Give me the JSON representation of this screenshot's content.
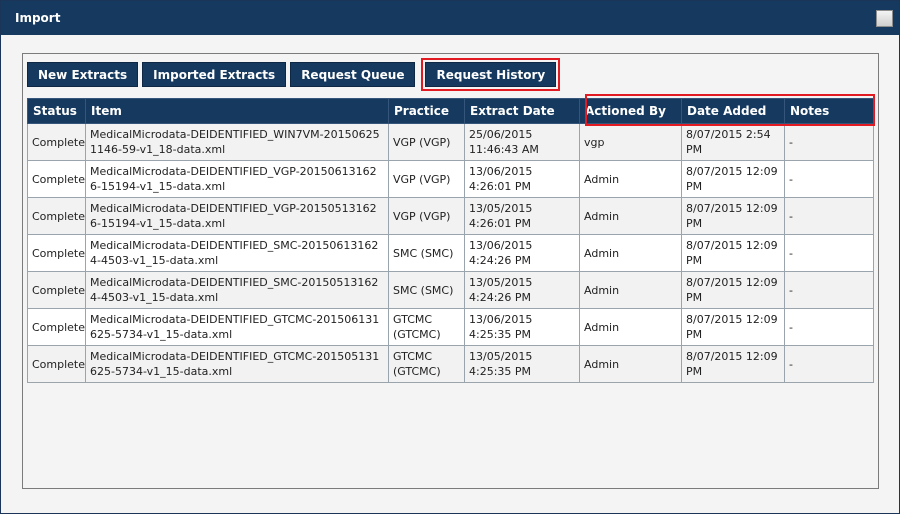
{
  "window": {
    "title": "Import"
  },
  "tabs": [
    {
      "label": "New Extracts"
    },
    {
      "label": "Imported Extracts"
    },
    {
      "label": "Request Queue"
    },
    {
      "label": "Request History"
    }
  ],
  "table": {
    "headers": [
      "Status",
      "Item",
      "Practice",
      "Extract Date",
      "Actioned By",
      "Date Added",
      "Notes"
    ],
    "rows": [
      [
        "Complete",
        "MedicalMicrodata-DEIDENTIFIED_WIN7VM-20150625\n1146-59-v1_18-data.xml",
        "VGP (VGP)",
        "25/06/2015\n11:46:43 AM",
        "vgp",
        "8/07/2015 2:54\nPM",
        "-"
      ],
      [
        "Complete",
        "MedicalMicrodata-DEIDENTIFIED_VGP-20150613162\n6-15194-v1_15-data.xml",
        "VGP (VGP)",
        "13/06/2015\n4:26:01 PM",
        "Admin",
        "8/07/2015 12:09\nPM",
        "-"
      ],
      [
        "Complete",
        "MedicalMicrodata-DEIDENTIFIED_VGP-20150513162\n6-15194-v1_15-data.xml",
        "VGP (VGP)",
        "13/05/2015\n4:26:01 PM",
        "Admin",
        "8/07/2015 12:09\nPM",
        "-"
      ],
      [
        "Complete",
        "MedicalMicrodata-DEIDENTIFIED_SMC-20150613162\n4-4503-v1_15-data.xml",
        "SMC (SMC)",
        "13/06/2015\n4:24:26 PM",
        "Admin",
        "8/07/2015 12:09\nPM",
        "-"
      ],
      [
        "Complete",
        "MedicalMicrodata-DEIDENTIFIED_SMC-20150513162\n4-4503-v1_15-data.xml",
        "SMC (SMC)",
        "13/05/2015\n4:24:26 PM",
        "Admin",
        "8/07/2015 12:09\nPM",
        "-"
      ],
      [
        "Complete",
        "MedicalMicrodata-DEIDENTIFIED_GTCMC-201506131\n625-5734-v1_15-data.xml",
        "GTCMC\n(GTCMC)",
        "13/06/2015\n4:25:35 PM",
        "Admin",
        "8/07/2015 12:09\nPM",
        "-"
      ],
      [
        "Complete",
        "MedicalMicrodata-DEIDENTIFIED_GTCMC-201505131\n625-5734-v1_15-data.xml",
        "GTCMC\n(GTCMC)",
        "13/05/2015\n4:25:35 PM",
        "Admin",
        "8/07/2015 12:09\nPM",
        "-"
      ]
    ]
  },
  "colors": {
    "header_bg": "#163a5f",
    "highlight": "#e21b23"
  }
}
